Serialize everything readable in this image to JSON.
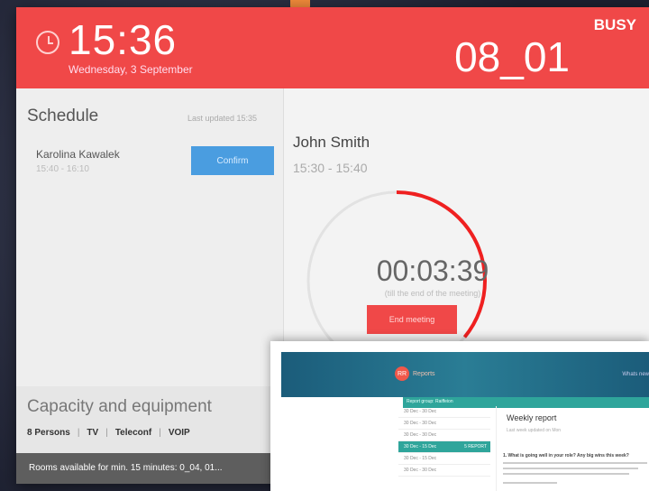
{
  "header": {
    "time": "15:36",
    "date": "Wednesday, 3 September",
    "room": "08_01",
    "status": "BUSY"
  },
  "schedule": {
    "title": "Schedule",
    "last_updated": "Last updated 15:35",
    "items": [
      {
        "name": "Karolina Kawalek",
        "time": "15:40 - 16:10",
        "button": "Confirm"
      }
    ]
  },
  "meeting": {
    "organizer": "John Smith",
    "time": "15:30 - 15:40",
    "countdown": "00:03:39",
    "countdown_note": "(till the end of the meeting)",
    "end_button": "End meeting",
    "progress_fraction": 0.36
  },
  "capacity": {
    "title": "Capacity and equipment",
    "items": [
      "8 Persons",
      "TV",
      "Teleconf",
      "VOIP"
    ]
  },
  "rooms_available": "Rooms available for min. 15 minutes:  0_04, 01...",
  "reports_app": {
    "app_name": "Reports",
    "logo_text": "RR",
    "header_right": "Whats new",
    "group_label": "Report group: Raiffeion",
    "list": [
      {
        "label": "30 Dec - 30 Dec",
        "count": ""
      },
      {
        "label": "30 Dec - 30 Dec",
        "count": ""
      },
      {
        "label": "30 Dec - 30 Dec",
        "count": ""
      },
      {
        "label": "30 Dec - 15 Dec",
        "count": "5 REPORT",
        "selected": true
      },
      {
        "label": "30 Dec - 15 Dec",
        "count": ""
      },
      {
        "label": "30 Dec - 30 Dec",
        "count": ""
      }
    ],
    "report_title": "Weekly report",
    "report_subtitle": "Last week updated on Mon",
    "question": "1. What is going well in your role? Any big wins this week?"
  },
  "colors": {
    "accent_red": "#f04848",
    "confirm_blue": "#4a9de0",
    "teal": "#2fa59b"
  }
}
